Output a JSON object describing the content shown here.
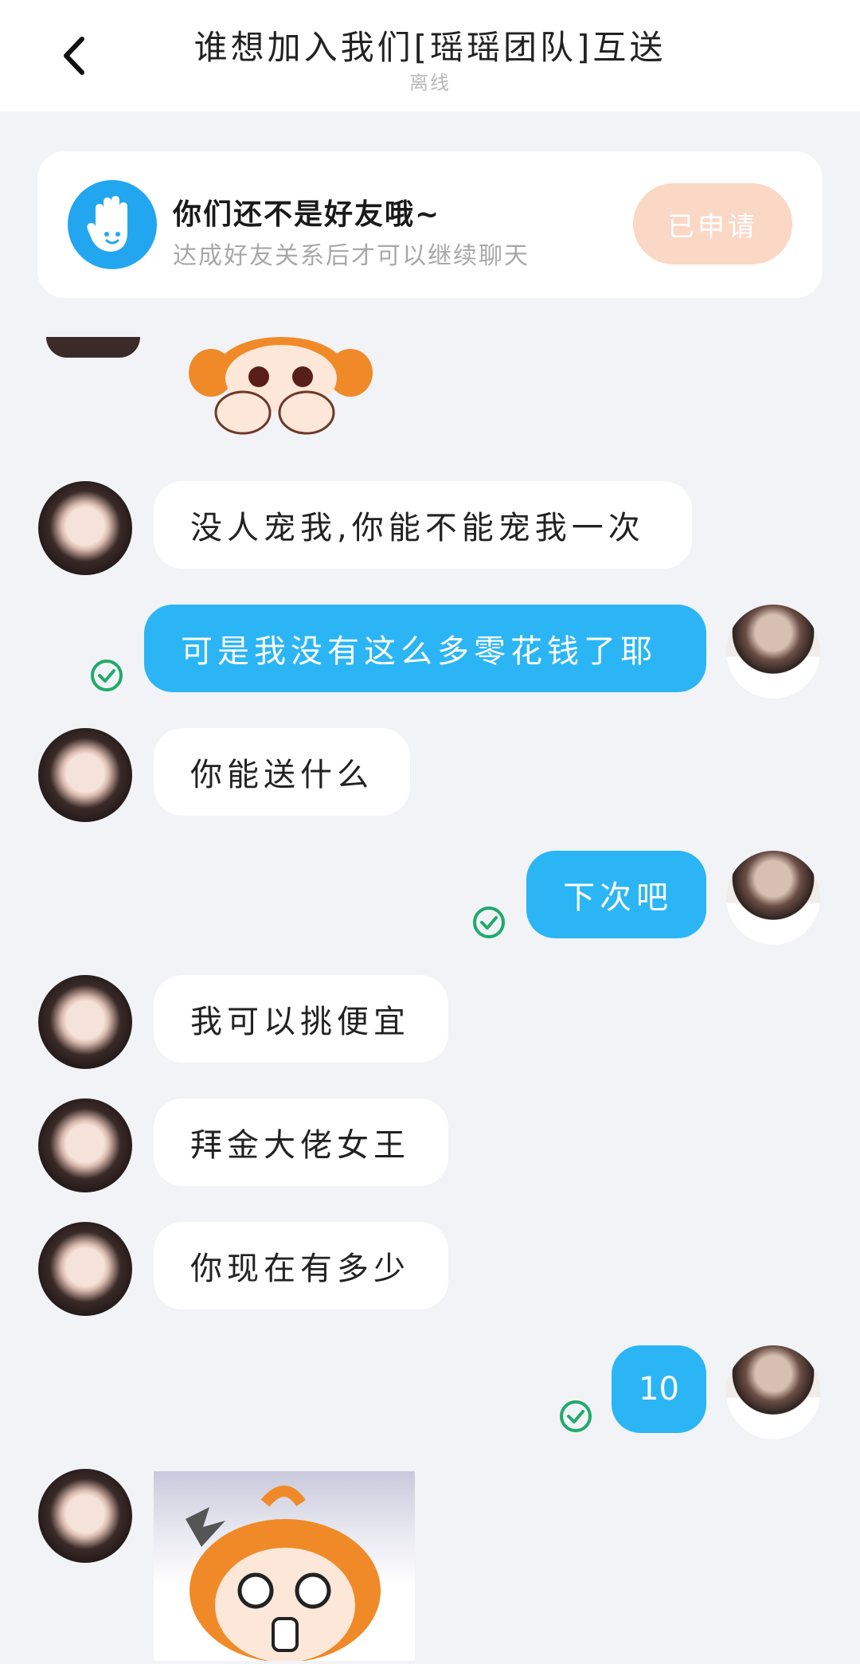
{
  "header": {
    "title": "谁想加入我们[瑶瑶团队]互送",
    "status": "离线"
  },
  "notice": {
    "title": "你们还不是好友哦~",
    "subtitle": "达成好友关系后才可以继续聊天",
    "apply_label": "已申请"
  },
  "colors": {
    "accent": "#2bb5f5",
    "apply_button": "#fbd7c6",
    "check": "#1faa6b"
  },
  "messages": [
    {
      "from": "other",
      "type": "sticker"
    },
    {
      "from": "other",
      "type": "text",
      "text": "没人宠我,你能不能宠我一次"
    },
    {
      "from": "self",
      "type": "text",
      "text": "可是我没有这么多零花钱了耶",
      "read": true
    },
    {
      "from": "other",
      "type": "text",
      "text": "你能送什么"
    },
    {
      "from": "self",
      "type": "text",
      "text": "下次吧",
      "read": true
    },
    {
      "from": "other",
      "type": "text",
      "text": "我可以挑便宜"
    },
    {
      "from": "other",
      "type": "text",
      "text": "拜金大佬女王"
    },
    {
      "from": "other",
      "type": "text",
      "text": "你现在有多少"
    },
    {
      "from": "self",
      "type": "text",
      "text": "10",
      "read": true
    },
    {
      "from": "other",
      "type": "sticker"
    }
  ]
}
